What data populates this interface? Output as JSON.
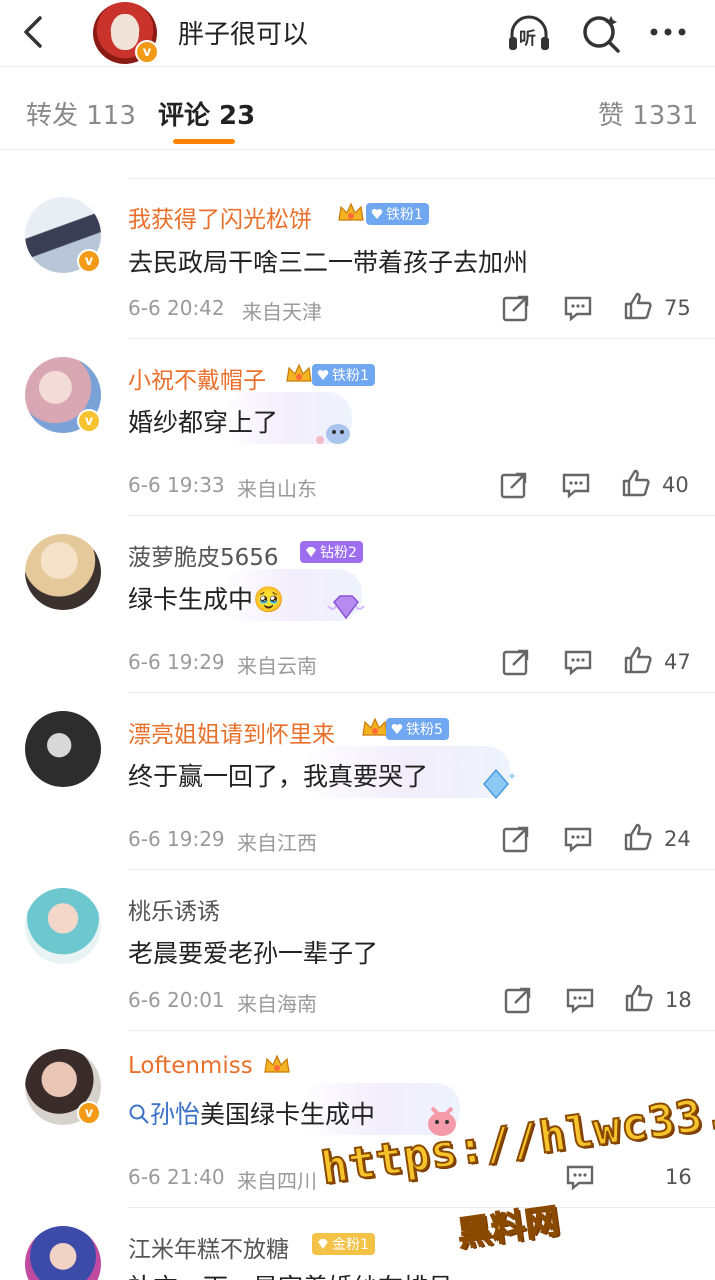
{
  "header": {
    "title": "胖子很可以",
    "listen_label": "听",
    "verified_mark": "v"
  },
  "tabs": [
    {
      "label": "转发 113"
    },
    {
      "label": "评论 23"
    },
    {
      "label": "赞 1331"
    }
  ],
  "colors": {
    "accent": "#ff8200",
    "vip_name": "#e8702a",
    "meta": "#9a9a9a"
  },
  "comments": [
    {
      "name": "我获得了闪光松饼",
      "fan_badge": "铁粉1",
      "text": "去民政局干啥三二一带着孩子去加州",
      "time": "6-6 20:42",
      "location": "来自天津",
      "likes": "75"
    },
    {
      "name": "小祝不戴帽子",
      "fan_badge": "铁粉1",
      "text": "婚纱都穿上了",
      "time": "6-6 19:33",
      "location": "来自山东",
      "likes": "40"
    },
    {
      "name": "菠萝脆皮5656",
      "fan_badge": "钻粉2",
      "text": "绿卡生成中",
      "emoji": "🥹",
      "time": "6-6 19:29",
      "location": "来自云南",
      "likes": "47"
    },
    {
      "name": "漂亮姐姐请到怀里来",
      "fan_badge": "铁粉5",
      "text": "终于赢一回了，我真要哭了",
      "time": "6-6 19:29",
      "location": "来自江西",
      "likes": "24"
    },
    {
      "name": "桃乐诱诱",
      "text": "老晨要爱老孙一辈子了",
      "time": "6-6 20:01",
      "location": "来自海南",
      "likes": "18"
    },
    {
      "name": "Loftenmiss",
      "search_term": "孙怡",
      "text": "美国绿卡生成中",
      "time": "6-6 21:40",
      "location": "来自四川",
      "likes": "16"
    },
    {
      "name": "江米年糕不放糖",
      "fan_badge": "金粉1",
      "text": "补充一下，是穿着婚纱在排号"
    }
  ],
  "watermark": {
    "url": "https://hlwc33.com",
    "site": "黑料网"
  }
}
